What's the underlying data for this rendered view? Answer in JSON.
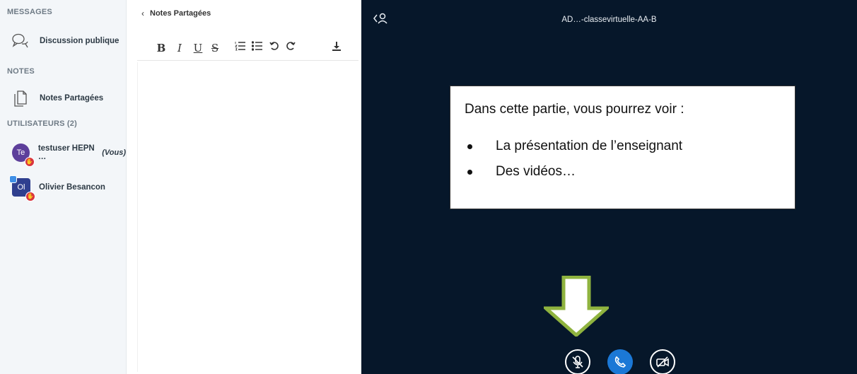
{
  "sidebar": {
    "messages_title": "MESSAGES",
    "public_chat_label": "Discussion publique",
    "notes_title": "NOTES",
    "shared_notes_label": "Notes Partagées",
    "users_title": "UTILISATEURS (2)",
    "users": [
      {
        "initials": "Te",
        "name": "testuser HEPN …",
        "you": "(Vous)",
        "avatar_shape": "round",
        "avatar_color": "#5d3f9b",
        "presenter": false
      },
      {
        "initials": "Ol",
        "name": "Olivier Besancon",
        "you": "",
        "avatar_shape": "square",
        "avatar_color": "#2f3f8f",
        "presenter": true
      }
    ]
  },
  "notes": {
    "back_label": "Notes Partagées",
    "toolbar": {
      "bold": "B",
      "italic": "I",
      "underline": "U",
      "strike": "S"
    }
  },
  "main": {
    "meeting_title": "AD…-classevirtuelle-AA-B",
    "callout": {
      "heading": "Dans cette partie, vous pourrez voir :",
      "items": [
        "La présentation de l’enseignant",
        "Des vidéos…"
      ]
    },
    "colors": {
      "background": "#06172a",
      "accent": "#1b78d6",
      "arrow": "#8fb33f"
    }
  }
}
